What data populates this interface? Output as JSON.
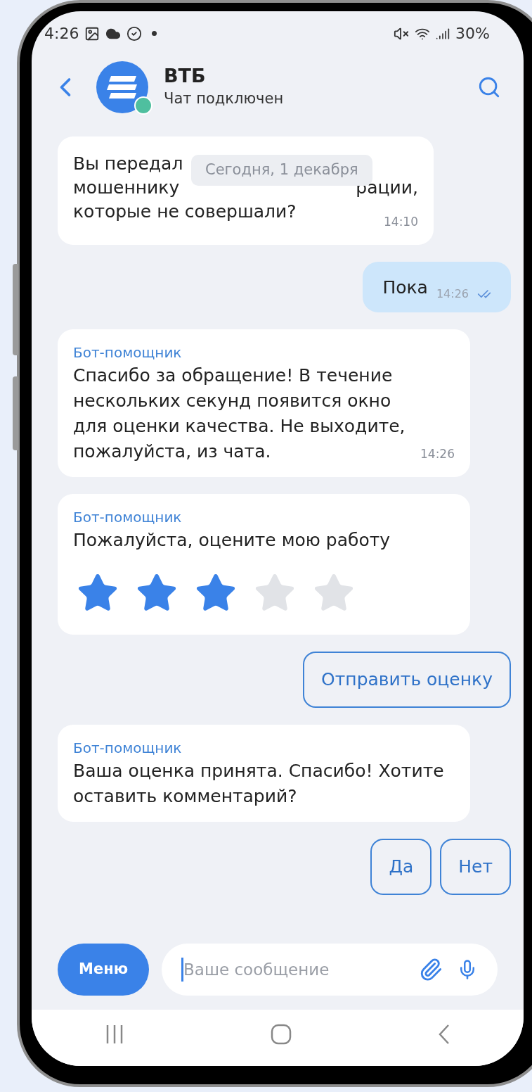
{
  "status_bar": {
    "time": "4:26",
    "battery": "30%"
  },
  "header": {
    "title": "ВТБ",
    "subtitle": "Чат подключен"
  },
  "date_pill": "Сегодня, 1 декабря",
  "messages": [
    {
      "kind": "partial",
      "rows": [
        {
          "left": "Вы передал"
        },
        {
          "left": "мошеннику",
          "right": "рации,"
        },
        {
          "left": "которые не совершали?"
        }
      ],
      "time": "14:10"
    },
    {
      "kind": "sent",
      "text": "Пока",
      "time": "14:26",
      "read": true
    },
    {
      "kind": "bot",
      "sender": "Бот-помощник",
      "text": "Спасибо за обращение! В течение нескольких секунд появится окно для оценки качества. Не выходите, пожалуйста, из чата.",
      "time": "14:26"
    },
    {
      "kind": "rating",
      "sender": "Бот-помощник",
      "text": "Пожалуйста, оцените мою работу",
      "stars": 3
    },
    {
      "kind": "actions",
      "buttons": [
        "Отправить оценку"
      ]
    },
    {
      "kind": "bot",
      "sender": "Бот-помощник",
      "text": "Ваша оценка принята. Спасибо! Хотите оставить комментарий?"
    },
    {
      "kind": "actions",
      "buttons": [
        "Да",
        "Нет"
      ]
    }
  ],
  "composer": {
    "menu": "Меню",
    "placeholder": "Ваше сообщение"
  }
}
